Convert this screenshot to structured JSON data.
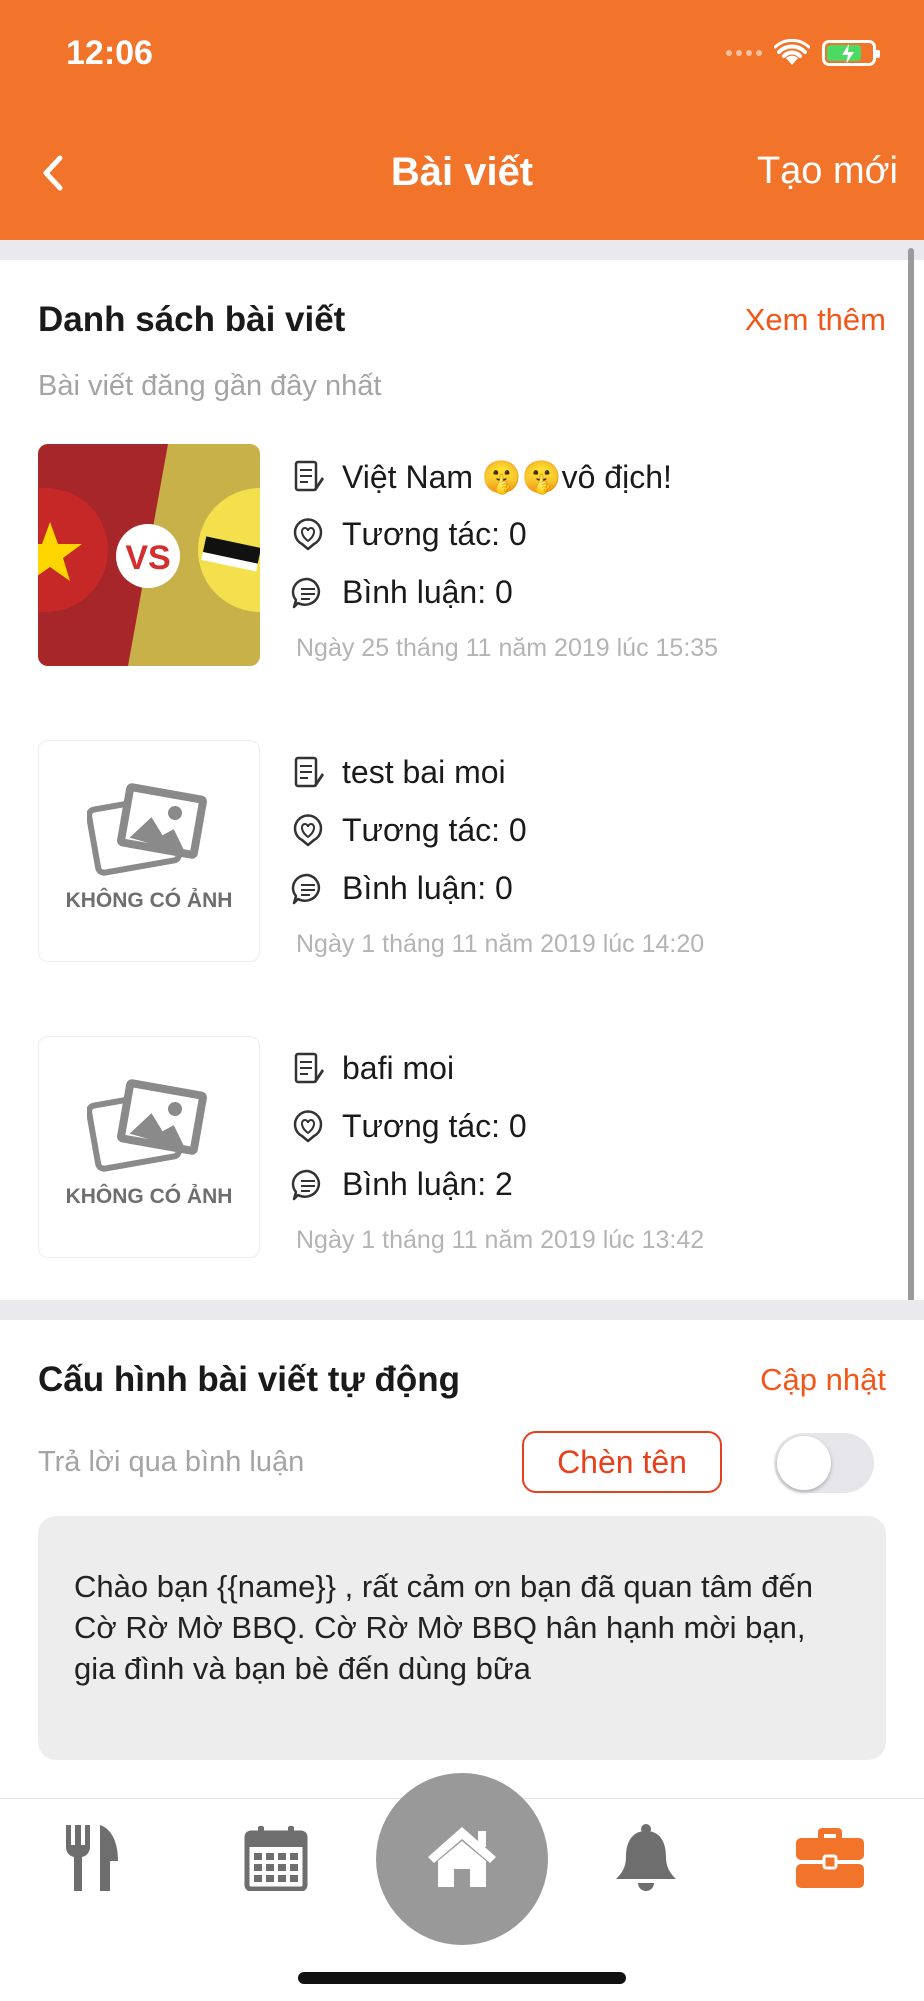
{
  "status_bar": {
    "time": "12:06"
  },
  "nav": {
    "title": "Bài viết",
    "action_label": "Tạo mới"
  },
  "posts_section": {
    "title": "Danh sách bài viết",
    "more_label": "Xem thêm",
    "subtitle": "Bài viết đăng gần đây nhất",
    "posts": [
      {
        "title": "Việt Nam 🤫🤫vô địch!",
        "interactions": "Tương tác: 0",
        "comments": "Bình luận: 0",
        "date": "Ngày 25 tháng 11 năm 2019 lúc 15:35",
        "thumbnail_text": "VS"
      },
      {
        "title": "test bai moi",
        "interactions": "Tương tác: 0",
        "comments": "Bình luận: 0",
        "date": "Ngày 1 tháng 11 năm 2019 lúc 14:20",
        "no_image_label": "KHÔNG CÓ ẢNH"
      },
      {
        "title": "bafi moi",
        "interactions": "Tương tác: 0",
        "comments": "Bình luận: 2",
        "date": "Ngày 1 tháng 11 năm 2019 lúc 13:42",
        "no_image_label": "KHÔNG CÓ ẢNH"
      }
    ]
  },
  "auto_section": {
    "title": "Cấu hình bài viết tự động",
    "update_label": "Cập nhật",
    "reply_label": "Trả lời qua bình luận",
    "insert_name_label": "Chèn tên",
    "toggle_on": false,
    "message": " Chào bạn {{name}} , rất cảm ơn bạn đã quan tâm đến Cờ Rờ Mờ BBQ. Cờ Rờ Mờ BBQ hân hạnh mời bạn, gia đình và bạn bè đến dùng bữa"
  },
  "tab_bar": {
    "items": [
      "fork-knife-icon",
      "calendar-icon",
      "home-icon",
      "bell-icon",
      "briefcase-icon"
    ],
    "active": "briefcase-icon"
  },
  "colors": {
    "accent": "#F2732A",
    "link": "#F2571A",
    "gray": "#999999"
  }
}
